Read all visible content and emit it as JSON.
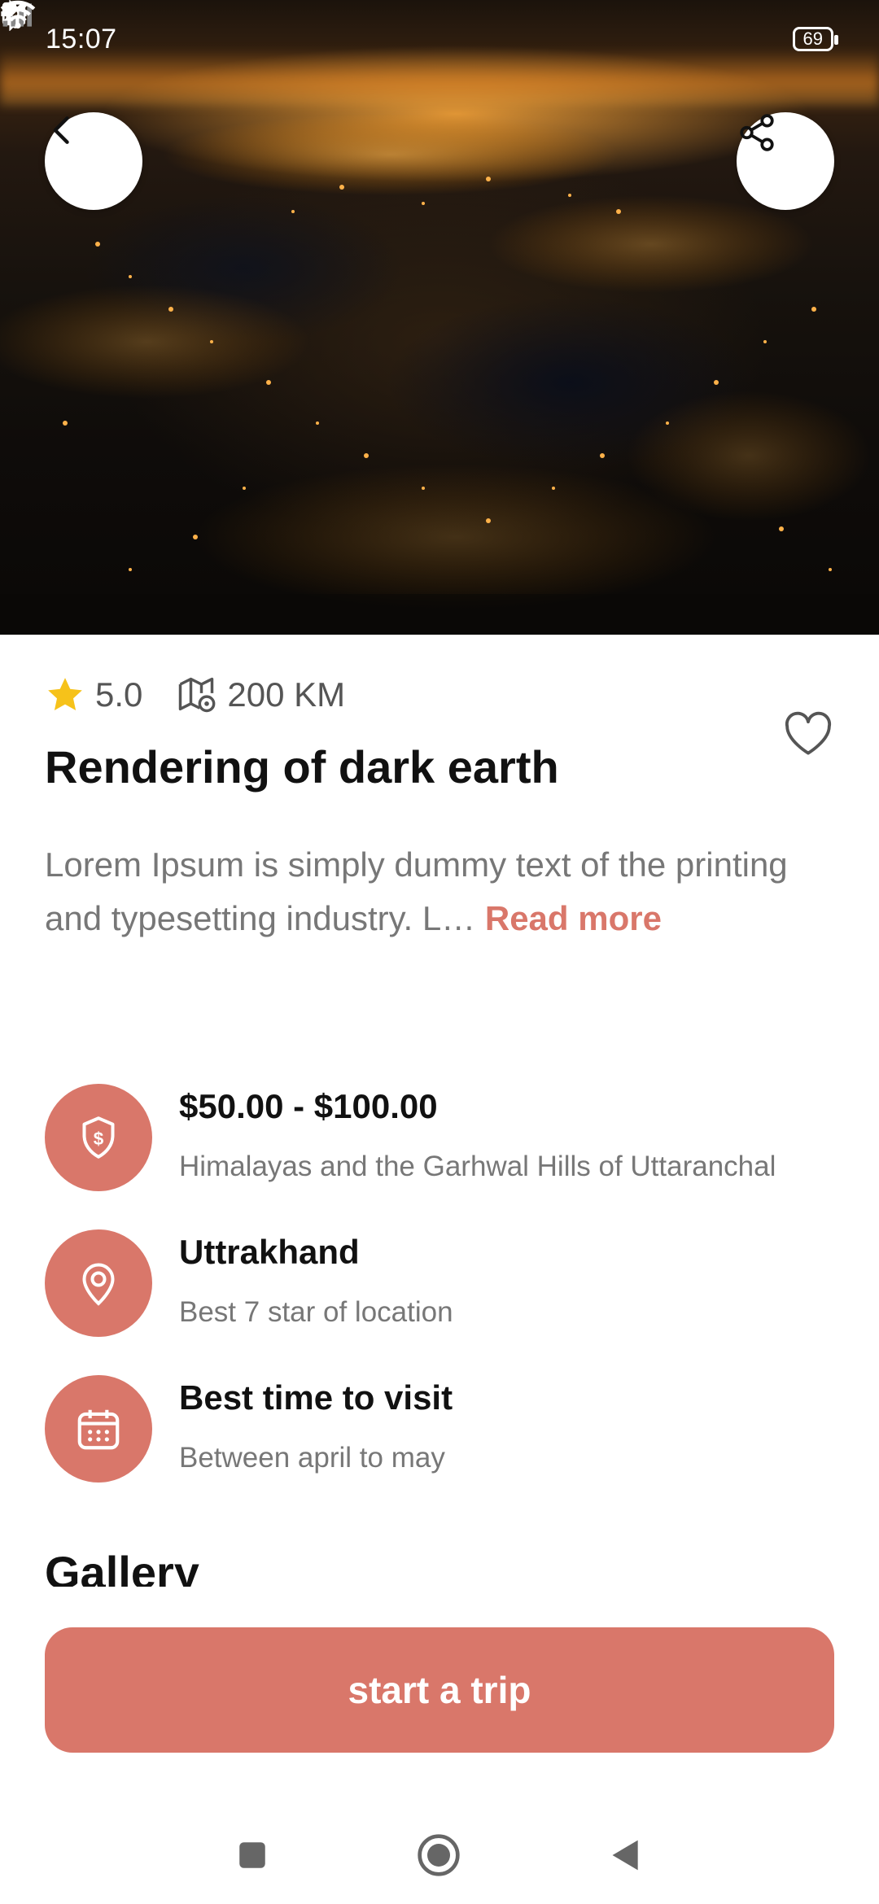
{
  "status_bar": {
    "time": "15:07",
    "battery": "69",
    "icons_left": [
      "muted-alarm-icon",
      "nfc-icon",
      "trash-icon",
      "settings-icon",
      "settings-icon"
    ],
    "icons_right": [
      "bluetooth-icon",
      "signal-icon",
      "wifi-icon",
      "battery-icon"
    ]
  },
  "header": {
    "back_icon": "chevron-left-icon",
    "share_icon": "share-icon"
  },
  "place": {
    "rating": "5.0",
    "distance": "200 KM",
    "title": "Rendering of dark earth",
    "description": "Lorem Ipsum is simply dummy text of the printing and typesetting industry. L…",
    "read_more": "Read more"
  },
  "details": [
    {
      "icon": "shield-dollar-icon",
      "title": "$50.00 - $100.00",
      "subtitle": "Himalayas and the Garhwal Hills of Uttaranchal"
    },
    {
      "icon": "location-pin-icon",
      "title": "Uttrakhand",
      "subtitle": "Best 7 star of location"
    },
    {
      "icon": "calendar-icon",
      "title": "Best time to visit",
      "subtitle": "Between april to may"
    }
  ],
  "gallery_title": "Gallery",
  "cta_label": "start a trip",
  "colors": {
    "accent": "#d9776a",
    "star": "#f6c21a"
  },
  "nav": [
    "recents-icon",
    "home-icon",
    "back-icon"
  ]
}
